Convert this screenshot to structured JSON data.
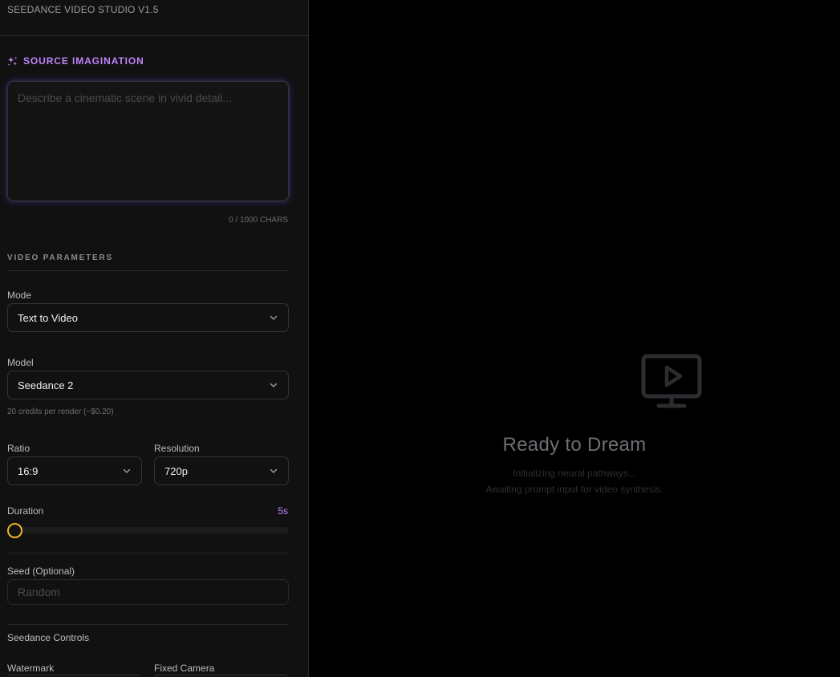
{
  "app": {
    "title": "SEEDANCE VIDEO STUDIO V1.5"
  },
  "source": {
    "heading": "SOURCE IMAGINATION",
    "icon": "sparkle-icon",
    "placeholder": "Describe a cinematic scene in vivid detail...",
    "value": "",
    "char_count": "0 / 1000 CHARS"
  },
  "params": {
    "heading": "VIDEO PARAMETERS",
    "mode": {
      "label": "Mode",
      "value": "Text to Video"
    },
    "model": {
      "label": "Model",
      "value": "Seedance 2",
      "hint": "20 credits per render (~$0.20)"
    },
    "ratio": {
      "label": "Ratio",
      "value": "16:9"
    },
    "resolution": {
      "label": "Resolution",
      "value": "720p"
    },
    "duration": {
      "label": "Duration",
      "value": "5s",
      "slider_fraction": 0
    },
    "seed": {
      "label": "Seed (Optional)",
      "placeholder": "Random",
      "value": ""
    }
  },
  "controls": {
    "heading": "Seedance Controls",
    "watermark_label": "Watermark",
    "fixed_camera_label": "Fixed Camera"
  },
  "preview": {
    "icon": "monitor-play-icon",
    "title": "Ready to Dream",
    "line1": "Initializing neural pathways...",
    "line2": "Awaiting prompt input for video synthesis."
  },
  "colors": {
    "accent_purple": "#c084fc",
    "slider_thumb": "#f0b429",
    "sidebar_bg": "#111111",
    "preview_bg": "#000000"
  }
}
